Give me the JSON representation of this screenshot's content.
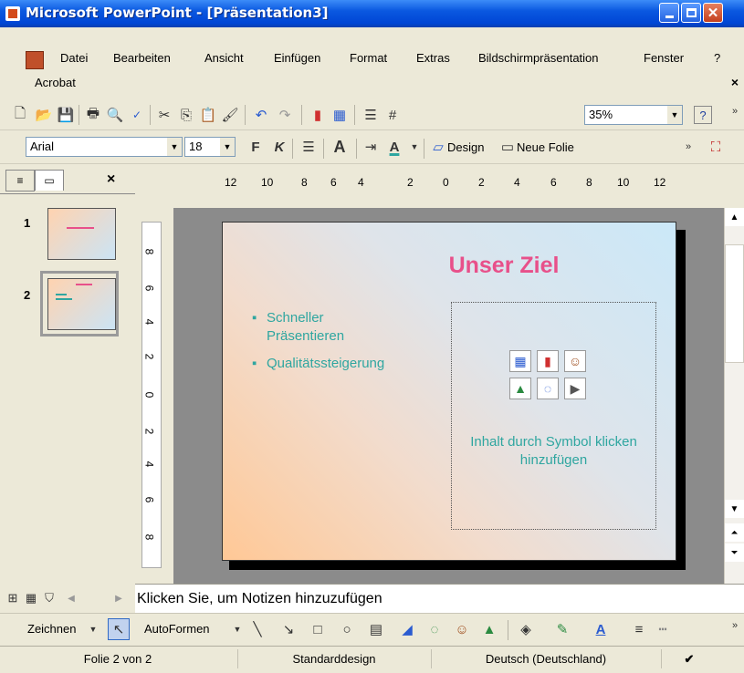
{
  "window": {
    "title": "Microsoft PowerPoint - [Präsentation3]"
  },
  "menu": {
    "items": [
      "Datei",
      "Bearbeiten",
      "Ansicht",
      "Einfügen",
      "Format",
      "Extras",
      "Bildschirmpräsentation",
      "Fenster",
      "?",
      "Acrobat"
    ],
    "close_glyph": "×"
  },
  "standard_toolbar": {
    "zoom": "35%",
    "icons": [
      "new-icon",
      "open-icon",
      "save-icon",
      "print-icon",
      "print-preview-icon",
      "spelling-icon",
      "cut-icon",
      "copy-icon",
      "paste-icon",
      "format-painter-icon",
      "undo-icon",
      "redo-icon",
      "chart-icon",
      "table-icon",
      "expand-icon",
      "grid-icon",
      "help-icon"
    ]
  },
  "format_toolbar": {
    "font": "Arial",
    "size": "18",
    "bold": "F",
    "italic": "K",
    "bigger_font": "A",
    "font_color": "A",
    "design": "Design",
    "new_slide": "Neue Folie"
  },
  "panel": {
    "close": "×",
    "slide_numbers": [
      "1",
      "2"
    ],
    "selected_slide": 2
  },
  "ruler": {
    "horizontal": [
      "12",
      "10",
      "8",
      "6",
      "4",
      "2",
      "0",
      "2",
      "4",
      "6",
      "8",
      "10",
      "12"
    ],
    "vertical": [
      "8",
      "6",
      "4",
      "2",
      "0",
      "2",
      "4",
      "6",
      "8"
    ]
  },
  "slide": {
    "title": "Unser Ziel",
    "bullets": [
      "Schneller Präsentieren",
      "Qualitätssteigerung"
    ],
    "content_placeholder": "Inhalt durch Symbol klicken hinzufügen",
    "colors": {
      "title": "#e8508a",
      "text": "#2fa6a0"
    }
  },
  "notes": {
    "placeholder": "Klicken Sie, um Notizen hinzuzufügen"
  },
  "draw_toolbar": {
    "draw": "Zeichnen",
    "autoshapes": "AutoFormen"
  },
  "status": {
    "slide": "Folie 2 von 2",
    "design": "Standarddesign",
    "language": "Deutsch (Deutschland)"
  }
}
